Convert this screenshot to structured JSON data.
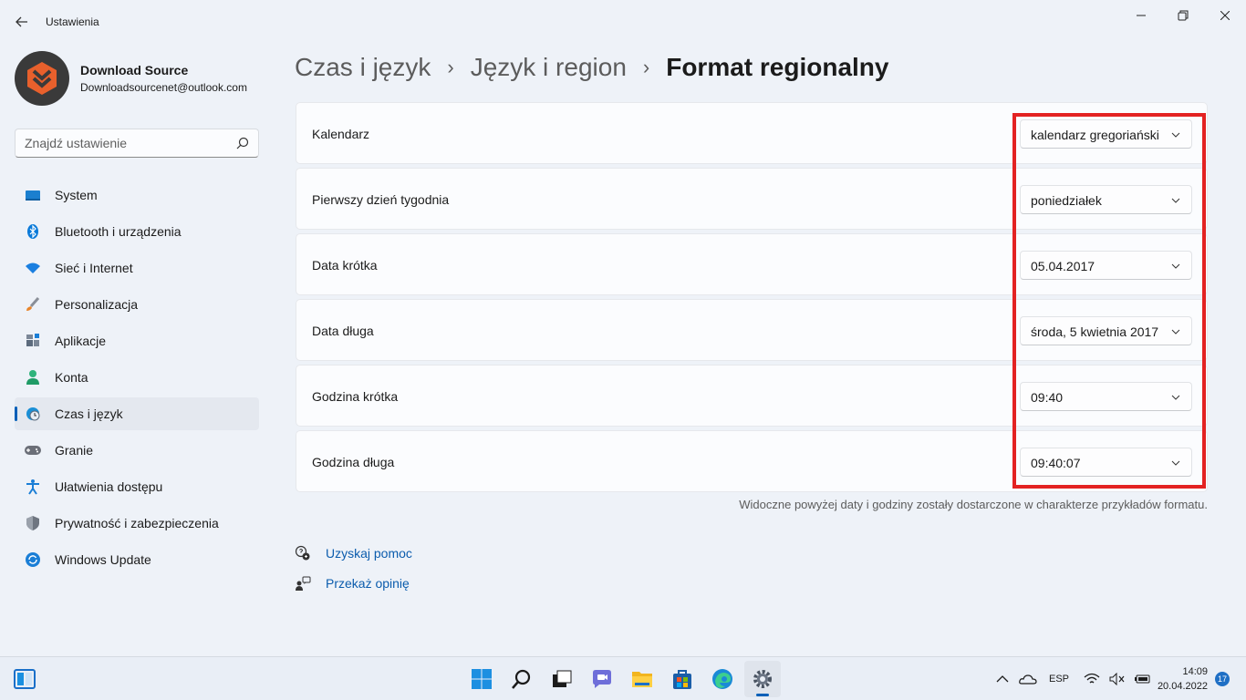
{
  "window": {
    "title": "Ustawienia",
    "back_icon": "back-arrow-icon",
    "minimize_icon": "minimize-icon",
    "maximize_icon": "restore-icon",
    "close_icon": "close-icon"
  },
  "profile": {
    "name": "Download Source",
    "email": "Downloadsourcenet@outlook.com",
    "avatar_icon": "download-source-logo"
  },
  "search": {
    "placeholder": "Znajdź ustawienie",
    "icon": "search-icon"
  },
  "sidebar": {
    "active_index": 6,
    "items": [
      {
        "label": "System",
        "icon": "monitor-icon",
        "color": "#1b7fcf"
      },
      {
        "label": "Bluetooth i urządzenia",
        "icon": "bluetooth-icon",
        "color": "#0a7ad9"
      },
      {
        "label": "Sieć i Internet",
        "icon": "wifi-icon",
        "color": "#1a7fe0"
      },
      {
        "label": "Personalizacja",
        "icon": "brush-icon",
        "color": "#e8842a"
      },
      {
        "label": "Aplikacje",
        "icon": "apps-icon",
        "color": "#5c6b7d"
      },
      {
        "label": "Konta",
        "icon": "person-icon",
        "color": "#2fb37b"
      },
      {
        "label": "Czas i język",
        "icon": "globe-clock-icon",
        "color": "#1a8fd6"
      },
      {
        "label": "Granie",
        "icon": "gamepad-icon",
        "color": "#6b6f78"
      },
      {
        "label": "Ułatwienia dostępu",
        "icon": "accessibility-icon",
        "color": "#1a7ed6"
      },
      {
        "label": "Prywatność i zabezpieczenia",
        "icon": "shield-icon",
        "color": "#6e7580"
      },
      {
        "label": "Windows Update",
        "icon": "update-icon",
        "color": "#1a7ed6"
      }
    ]
  },
  "breadcrumb": {
    "items": [
      "Czas i język",
      "Język i region",
      "Format regionalny"
    ],
    "separator": "›"
  },
  "settings": [
    {
      "label": "Kalendarz",
      "value": "kalendarz gregoriański"
    },
    {
      "label": "Pierwszy dzień tygodnia",
      "value": "poniedziałek"
    },
    {
      "label": "Data krótka",
      "value": "05.04.2017"
    },
    {
      "label": "Data długa",
      "value": "środa, 5 kwietnia 2017"
    },
    {
      "label": "Godzina krótka",
      "value": "09:40"
    },
    {
      "label": "Godzina długa",
      "value": "09:40:07"
    }
  ],
  "note": "Widoczne powyżej daty i godziny zostały dostarczone w charakterze przykładów formatu.",
  "links": {
    "help": "Uzyskaj pomoc",
    "feedback": "Przekaż opinię"
  },
  "taskbar": {
    "apps": [
      "start-icon",
      "search-icon",
      "task-view-icon",
      "chat-icon",
      "file-explorer-icon",
      "store-icon",
      "edge-icon",
      "settings-icon"
    ],
    "language": "ESP",
    "time": "14:09",
    "date": "20.04.2022",
    "notifications": "17"
  },
  "colors": {
    "accent": "#005fb8",
    "highlight_border": "#e32222",
    "link": "#0b5cad"
  }
}
